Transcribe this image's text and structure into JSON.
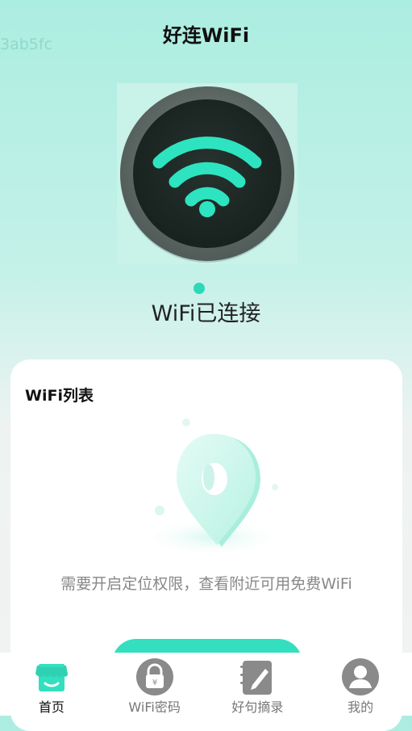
{
  "watermark": "3ab5fc",
  "header": {
    "title": "好连WiFi"
  },
  "status": {
    "text": "WiFi已连接"
  },
  "wifi_list": {
    "title": "WiFi列表",
    "message": "需要开启定位权限，查看附近可用免费WiFi"
  },
  "tabs": [
    {
      "label": "首页",
      "icon": "store-icon",
      "active": true
    },
    {
      "label": "WiFi密码",
      "icon": "lock-icon",
      "active": false
    },
    {
      "label": "好句摘录",
      "icon": "notebook-pen-icon",
      "active": false
    },
    {
      "label": "我的",
      "icon": "user-icon",
      "active": false
    }
  ],
  "colors": {
    "accent": "#33DFBE",
    "wifi_glyph": "#2EE3C0",
    "hero_dark": "#1F2B29",
    "hero_ring": "#5F6B68"
  }
}
